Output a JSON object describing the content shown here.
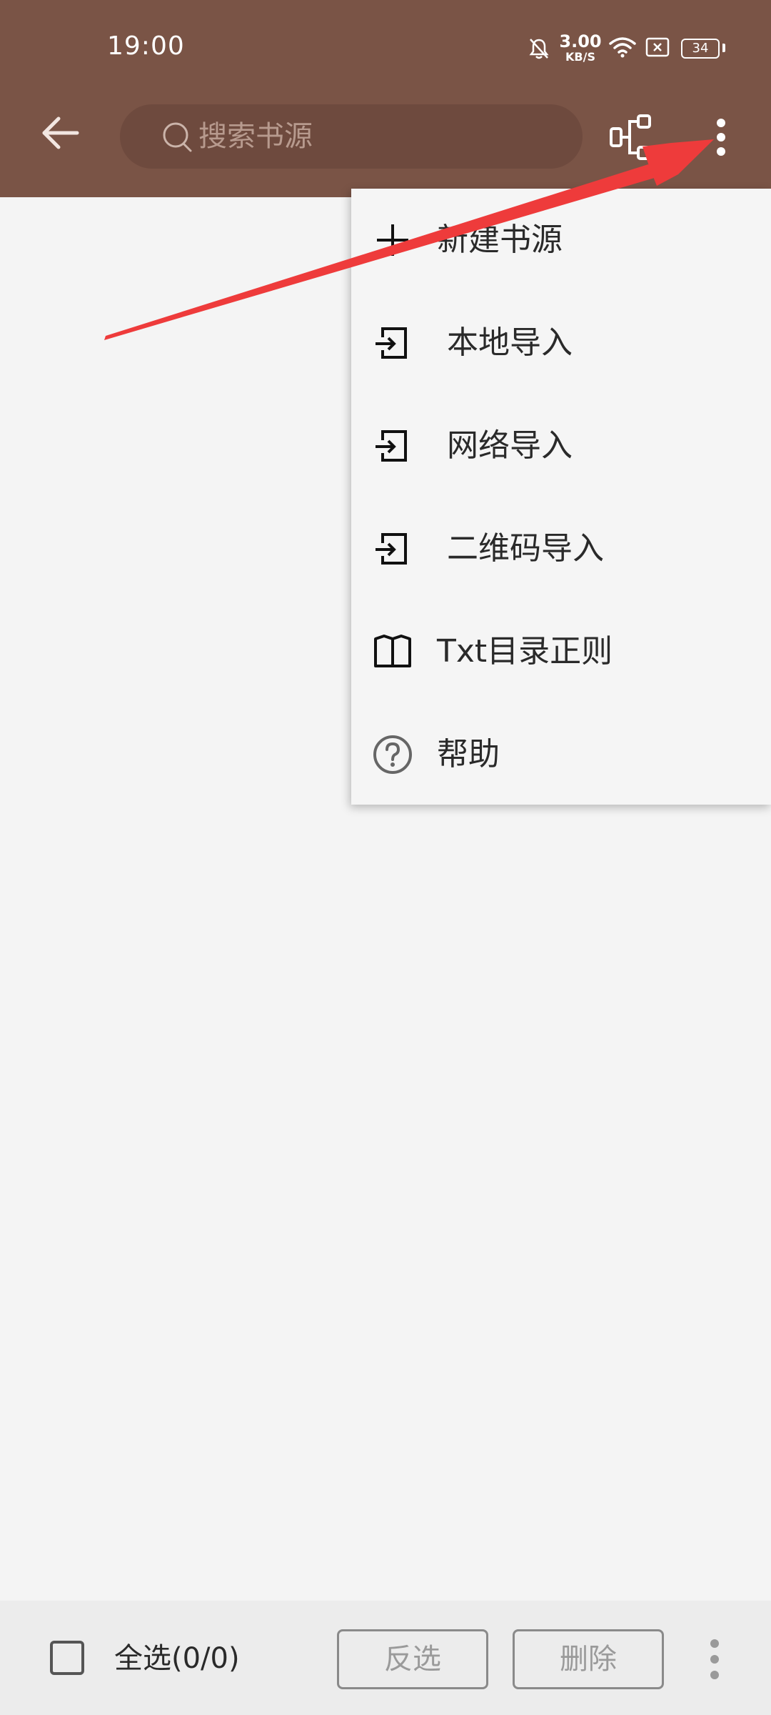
{
  "status_bar": {
    "time": "19:00",
    "speed_value": "3.00",
    "speed_unit": "KB/S",
    "battery": "34"
  },
  "toolbar": {
    "search_placeholder": "搜索书源"
  },
  "menu": {
    "items": [
      {
        "label": "新建书源",
        "icon": "plus-icon"
      },
      {
        "label": "本地导入",
        "icon": "import-icon"
      },
      {
        "label": "网络导入",
        "icon": "import-icon"
      },
      {
        "label": "二维码导入",
        "icon": "import-icon"
      },
      {
        "label": "Txt目录正则",
        "icon": "book-icon"
      },
      {
        "label": "帮助",
        "icon": "help-icon"
      }
    ]
  },
  "bottom_bar": {
    "select_all": "全选(0/0)",
    "invert": "反选",
    "delete": "删除"
  },
  "colors": {
    "appbar": "#7a5446",
    "search_bg": "#6e4a3e",
    "background": "#f4f4f4",
    "menu_bg": "#f5f5f5",
    "annotation_arrow": "#ee3b3b"
  }
}
